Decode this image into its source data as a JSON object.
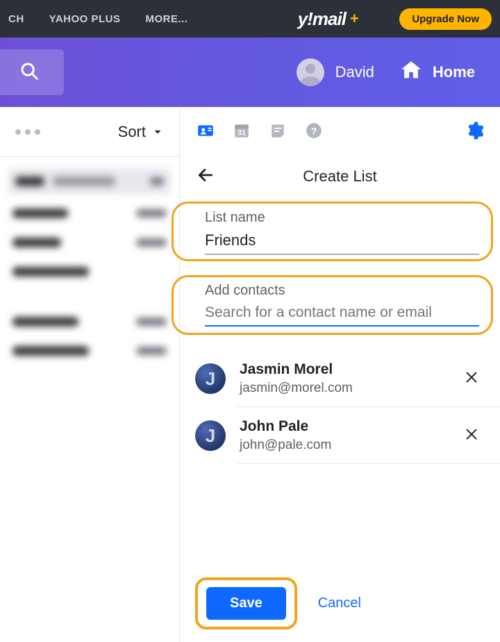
{
  "topbar": {
    "nav": [
      "CH",
      "YAHOO PLUS",
      "MORE..."
    ],
    "logo_text": "y!mail",
    "logo_plus": "+",
    "upgrade": "Upgrade Now"
  },
  "subbar": {
    "user_name": "David",
    "home": "Home"
  },
  "leftcol": {
    "sort_label": "Sort"
  },
  "panel": {
    "title": "Create List",
    "list_name_label": "List name",
    "list_name_value": "Friends",
    "add_contacts_label": "Add contacts",
    "search_placeholder": "Search for a contact name or email"
  },
  "contacts": [
    {
      "initial": "J",
      "name": "Jasmin Morel",
      "email": "jasmin@morel.com"
    },
    {
      "initial": "J",
      "name": "John Pale",
      "email": "john@pale.com"
    }
  ],
  "footer": {
    "save": "Save",
    "cancel": "Cancel"
  },
  "toolbar": {
    "calendar_day": "31"
  }
}
